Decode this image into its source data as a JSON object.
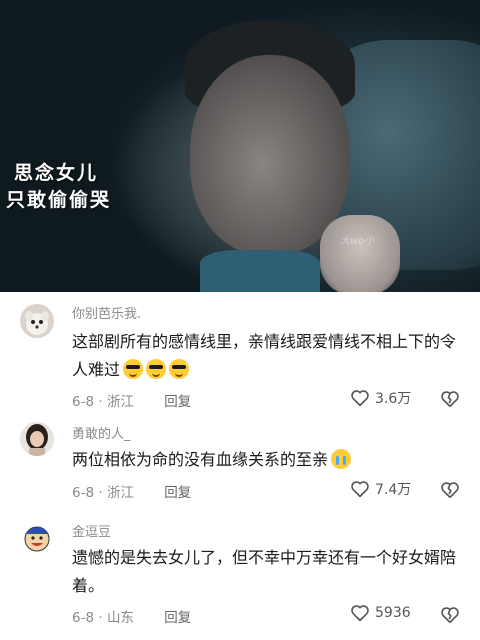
{
  "video": {
    "caption_line1": "思念女儿",
    "caption_line2": "只敢偷偷哭",
    "watermark": "大wo小"
  },
  "comments": [
    {
      "username": "你别芭乐我.",
      "text": "这部剧所有的感情线里，亲情线跟爱情线不相上下的令人难过",
      "emoji": [
        "cool-emoji",
        "cool-emoji",
        "cool-emoji"
      ],
      "date": "6-8",
      "location": "浙江",
      "reply_label": "回复",
      "likes": "3.6万"
    },
    {
      "username": "勇敢的人_",
      "text": "两位相依为命的没有血缘关系的至亲",
      "emoji": [
        "crying-emoji"
      ],
      "date": "6-8",
      "location": "浙江",
      "reply_label": "回复",
      "likes": "7.4万"
    },
    {
      "username": "金逗豆",
      "text": "遗憾的是失去女儿了，但不幸中万幸还有一个好女婿陪着。",
      "emoji": [],
      "date": "6-8",
      "location": "山东",
      "reply_label": "回复",
      "likes": "5936"
    }
  ],
  "colors": {
    "meta_text": "#8a8a8a",
    "body_text": "#1a1a1a"
  }
}
